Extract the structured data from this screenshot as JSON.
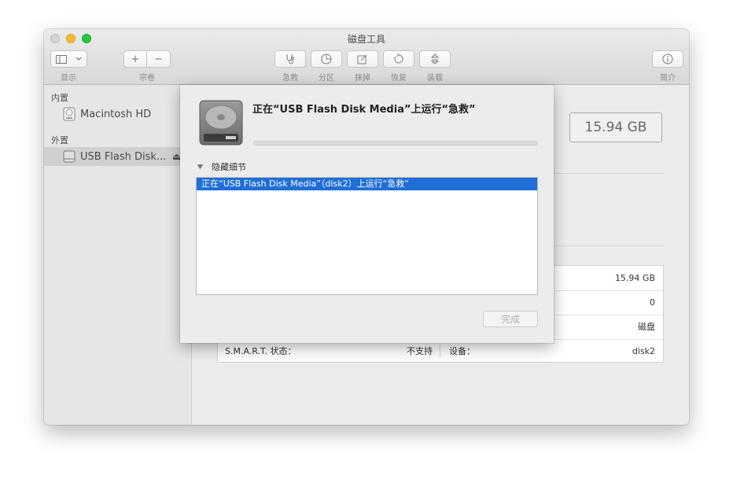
{
  "window": {
    "title": "磁盘工具"
  },
  "toolbar": {
    "view_label": "显示",
    "volume_label": "宗卷",
    "volume_add": "+",
    "volume_remove": "−",
    "first_aid_label": "急救",
    "partition_label": "分区",
    "erase_label": "抹掉",
    "restore_label": "恢复",
    "mount_label": "装载",
    "info_label": "简介"
  },
  "sidebar": {
    "internal_header": "内置",
    "external_header": "外置",
    "items": [
      {
        "label": "Macintosh HD"
      },
      {
        "label": "USB Flash Disk..."
      }
    ],
    "eject_symbol": "⏏"
  },
  "main": {
    "capacity": "15.94 GB",
    "table_rows": [
      {
        "right_value": "15.94 GB"
      },
      {
        "right_value": "0"
      },
      {
        "right_value": "磁盘"
      },
      {
        "left_label": "S.M.A.R.T. 状态：",
        "left_value": "不支持",
        "right_label": "设备：",
        "right_value": "disk2"
      }
    ]
  },
  "sheet": {
    "title": "正在“USB Flash Disk Media”上运行“急救”",
    "progress": 0,
    "disclosure_label": "隐藏细节",
    "log_lines": [
      "正在“USB Flash Disk Media”（disk2）上运行“急救”"
    ],
    "done_label": "完成"
  },
  "colors": {
    "accent": "#1f6fd6",
    "close": "#d7d7d7",
    "minimize": "#fdbc2e",
    "maximize": "#28c840"
  },
  "icons": [
    "sidebar-toggle-icon",
    "chevron-down-icon",
    "stethoscope-icon",
    "pie-chart-icon",
    "erase-icon",
    "restore-icon",
    "mount-icon",
    "info-icon",
    "disk-icon",
    "usb-drive-icon",
    "eject-icon",
    "hard-drive-icon",
    "disclosure-triangle-icon"
  ]
}
